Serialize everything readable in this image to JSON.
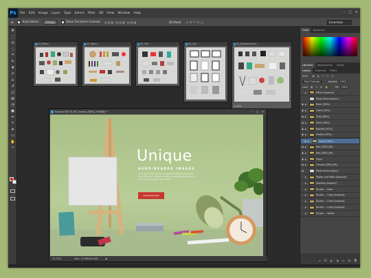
{
  "app": {
    "logo": "Ps"
  },
  "menu": [
    "File",
    "Edit",
    "Image",
    "Layer",
    "Type",
    "Select",
    "Filter",
    "3D",
    "View",
    "Window",
    "Help"
  ],
  "options": {
    "auto_select_label": "Auto-Select:",
    "auto_select_value": "Group",
    "show_transform": "Show Transform Controls",
    "mode_3d": "3D Mode:",
    "workspace": "Essentials"
  },
  "tools": [
    "move-icon",
    "marquee-icon",
    "lasso-icon",
    "quick-select-icon",
    "crop-icon",
    "eyedropper-icon",
    "healing-icon",
    "brush-icon",
    "clone-stamp-icon",
    "history-brush-icon",
    "eraser-icon",
    "gradient-icon",
    "blur-icon",
    "dodge-icon",
    "pen-icon",
    "type-icon",
    "path-select-icon",
    "shape-icon",
    "hand-icon",
    "zoom-icon"
  ],
  "tool_glyphs": [
    "✥",
    "⬚",
    "ʘ",
    "◌",
    "⌗",
    "✎",
    "✚",
    "✐",
    "♙",
    "↺",
    "◫",
    "▤",
    "◔",
    "●",
    "✒",
    "T",
    "➤",
    "▭",
    "✋",
    "⌕"
  ],
  "thumbs": [
    {
      "title": "01_Items..."
    },
    {
      "title": "02_Items..."
    },
    {
      "title": "03_Cat..."
    },
    {
      "title": "04_Cat..."
    },
    {
      "title": "05_Environments..."
    }
  ],
  "thumb5_zoom": "8.33%",
  "main_window": {
    "title": "full.psd @ 33.3% (Lamp [38%], RGB/8) *",
    "zoom": "33.33%",
    "doc": "Doc: 12.9M/410.8M",
    "heading": "Unique",
    "subheading": "HERO/HEADER IMAGES",
    "body": "Lorem ipsum dolor sit amet consectetur adipiscing elit sed do eiusmod tempor incididunt ut labore et dolore magna aliqua ut enim ad minim veniam quis nostrud.",
    "cta": "PURCHASE NOW"
  },
  "panels": {
    "top_tabs": [
      "Color",
      "Swatches"
    ],
    "mid_tabs": [
      "Libraries",
      "Adjustments",
      "Styles"
    ],
    "layer_tabs": [
      "Layers",
      "Channels",
      "Paths"
    ],
    "kind": "Kind",
    "blend": "Pass Through",
    "opacity_label": "Opacity:",
    "opacity": "100%",
    "lock_label": "Lock:",
    "fill_label": "Fill:",
    "fill": "100%"
  },
  "layers": [
    {
      "name": "Effect [expand]",
      "type": "folder",
      "visible": false
    },
    {
      "name": "Paste Items below :)",
      "type": "pixel",
      "visible": false
    },
    {
      "name": "Ruler [38%]",
      "type": "folder",
      "visible": true
    },
    {
      "name": "Clock [32%]",
      "type": "folder",
      "visible": true
    },
    {
      "name": "Tulip [38%]",
      "type": "folder",
      "visible": true
    },
    {
      "name": "Plant [38%]",
      "type": "folder",
      "visible": true
    },
    {
      "name": "Booklet [32%]",
      "type": "folder",
      "visible": true
    },
    {
      "name": "Chalks [32%]",
      "type": "folder",
      "visible": true
    },
    {
      "name": "Lamp [38%]",
      "type": "folder",
      "visible": true,
      "selected": true
    },
    {
      "name": "Box [38%] [fit]",
      "type": "folder",
      "visible": true
    },
    {
      "name": "Box [38%] [fit]",
      "type": "folder",
      "visible": true
    },
    {
      "name": "Trays",
      "type": "folder",
      "visible": true
    },
    {
      "name": "Canvas [38%] [fit]",
      "type": "folder",
      "visible": true
    },
    {
      "name": "Paste Items above !",
      "type": "pixel",
      "visible": true
    },
    {
      "name": "Tables and Walls [expand]",
      "type": "folder",
      "visible": false
    },
    {
      "name": "Shadow [expand]",
      "type": "folder",
      "visible": false
    },
    {
      "name": "Studio — Dark",
      "type": "folder",
      "visible": false
    },
    {
      "name": "Studio — Color [expand]",
      "type": "folder",
      "visible": false
    },
    {
      "name": "Studio — Color [expand]",
      "type": "folder",
      "visible": false
    },
    {
      "name": "Studio — Color [expand]",
      "type": "folder",
      "visible": false
    },
    {
      "name": "Studio — White",
      "type": "folder",
      "visible": false
    }
  ],
  "layer_footer": [
    "link-icon",
    "fx-icon",
    "mask-icon",
    "adjustment-icon",
    "group-icon",
    "new-layer-icon",
    "trash-icon"
  ],
  "layer_footer_glyphs": [
    "∞",
    "fx",
    "◐",
    "◑",
    "▭",
    "⊞",
    "🗑"
  ]
}
